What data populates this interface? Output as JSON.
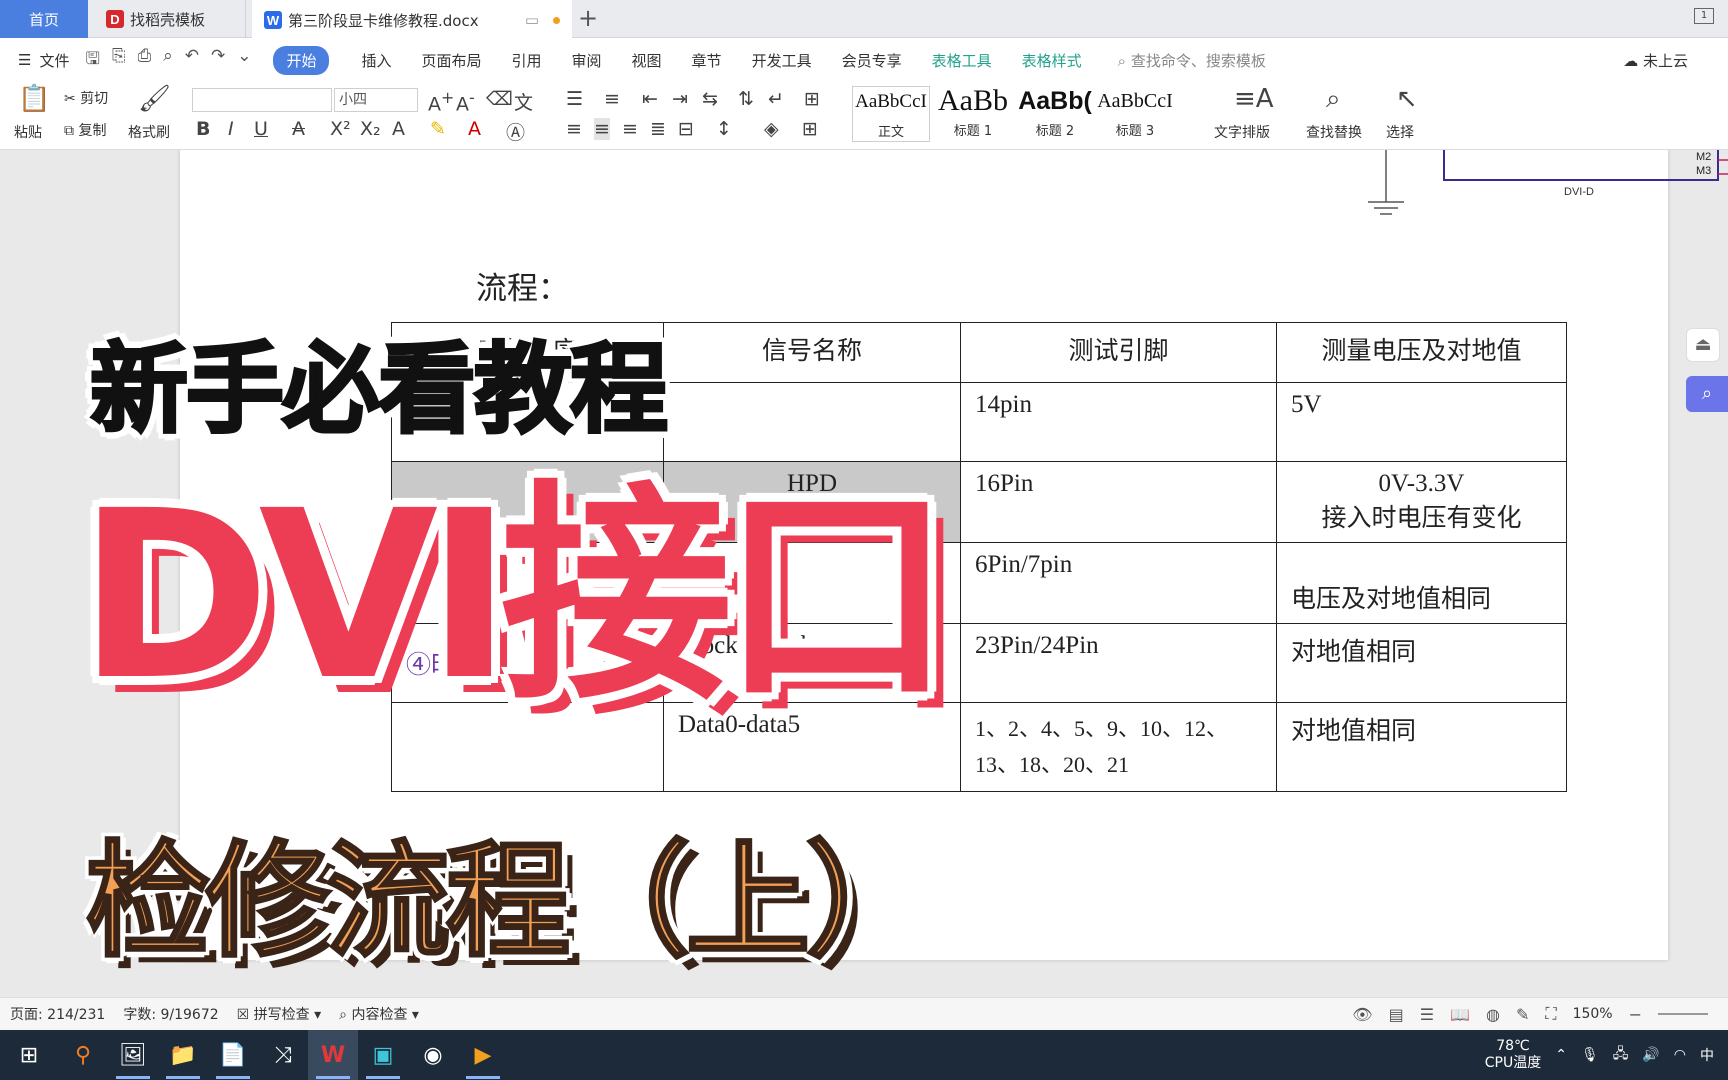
{
  "tabs": {
    "home": "首页",
    "template": "找稻壳模板",
    "document": "第三阶段显卡维修教程.docx"
  },
  "menu": {
    "file": "文件",
    "items": [
      "开始",
      "插入",
      "页面布局",
      "引用",
      "审阅",
      "视图",
      "章节",
      "开发工具",
      "会员专享"
    ],
    "table_tools": "表格工具",
    "table_style": "表格样式",
    "search_placeholder": "查找命令、搜索模板",
    "cloud_status": "未上云"
  },
  "ribbon": {
    "paste": "粘贴",
    "cut": "剪切",
    "copy": "复制",
    "format_painter": "格式刷",
    "font_size": "小四",
    "styles": [
      {
        "sample": "AaBbCcI",
        "name": "正文"
      },
      {
        "sample": "AaBb",
        "name": "标题 1"
      },
      {
        "sample": "AaBb(",
        "name": "标题 2"
      },
      {
        "sample": "AaBbCcI",
        "name": "标题 3"
      }
    ],
    "text_layout": "文字排版",
    "find_replace": "查找替换",
    "select": "选择"
  },
  "document": {
    "heading_fragment": "流程：",
    "table": {
      "headers": [
        "工作时序",
        "信号名称",
        "测试引脚",
        "测量电压及对地值"
      ],
      "rows": [
        [
          "",
          "",
          "14pin",
          "5V"
        ],
        [
          "",
          "HPD",
          "16Pin",
          "0V-3.3V\n接入时电压有变化"
        ],
        [
          "",
          "",
          "6Pin/7pin",
          "\n电压及对地值相同"
        ],
        [
          "④时钟",
          "Clock+/clock-",
          "23Pin/24Pin",
          "对地值相同"
        ],
        [
          "",
          "Data0-data5",
          "1、2、4、5、9、10、12、13、18、20、21",
          "对地值相同"
        ]
      ]
    },
    "schematic": {
      "labels": [
        "M2",
        "M3",
        "M2",
        "M3",
        "DVI-D"
      ]
    }
  },
  "overlay": {
    "line1": "新手必看教程",
    "line2": "DVI接口",
    "line3": "检修流程（上）"
  },
  "statusbar": {
    "page": "页面: 214/231",
    "words": "字数: 9/19672",
    "spell_check": "拼写检查",
    "content_check": "内容检查",
    "zoom": "150%"
  },
  "taskbar": {
    "temperature": "78℃",
    "temp_label": "CPU温度",
    "ime": "中"
  }
}
